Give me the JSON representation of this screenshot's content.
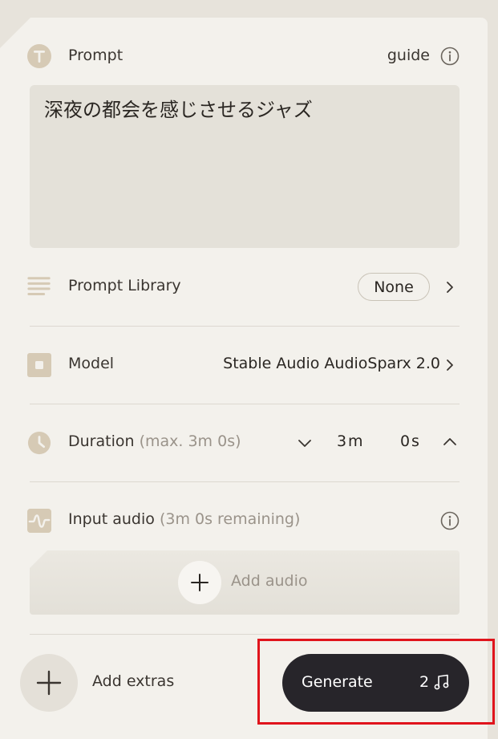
{
  "prompt": {
    "label": "Prompt",
    "guide_label": "guide",
    "text": "深夜の都会を感じさせるジャズ",
    "icon": "text-t-icon"
  },
  "prompt_library": {
    "label": "Prompt Library",
    "value": "None",
    "icon": "list-lines-icon"
  },
  "model": {
    "label": "Model",
    "value": "Stable Audio AudioSparx 2.0",
    "icon": "model-square-icon"
  },
  "duration": {
    "label": "Duration",
    "hint": "(max. 3m 0s)",
    "minutes": "3",
    "minutes_unit": "m",
    "seconds": "0",
    "seconds_unit": "s",
    "icon": "clock-icon"
  },
  "input_audio": {
    "label": "Input audio",
    "hint": "(3m 0s remaining)",
    "add_label": "Add audio",
    "icon": "waveform-icon"
  },
  "footer": {
    "extras_label": "Add extras",
    "generate_label": "Generate",
    "generate_count": "2"
  },
  "colors": {
    "background": "#e7e3db",
    "panel": "#f3f1ec",
    "icon_accent": "#d6cab5",
    "generate_button": "#27252a",
    "highlight": "#e0141c"
  }
}
